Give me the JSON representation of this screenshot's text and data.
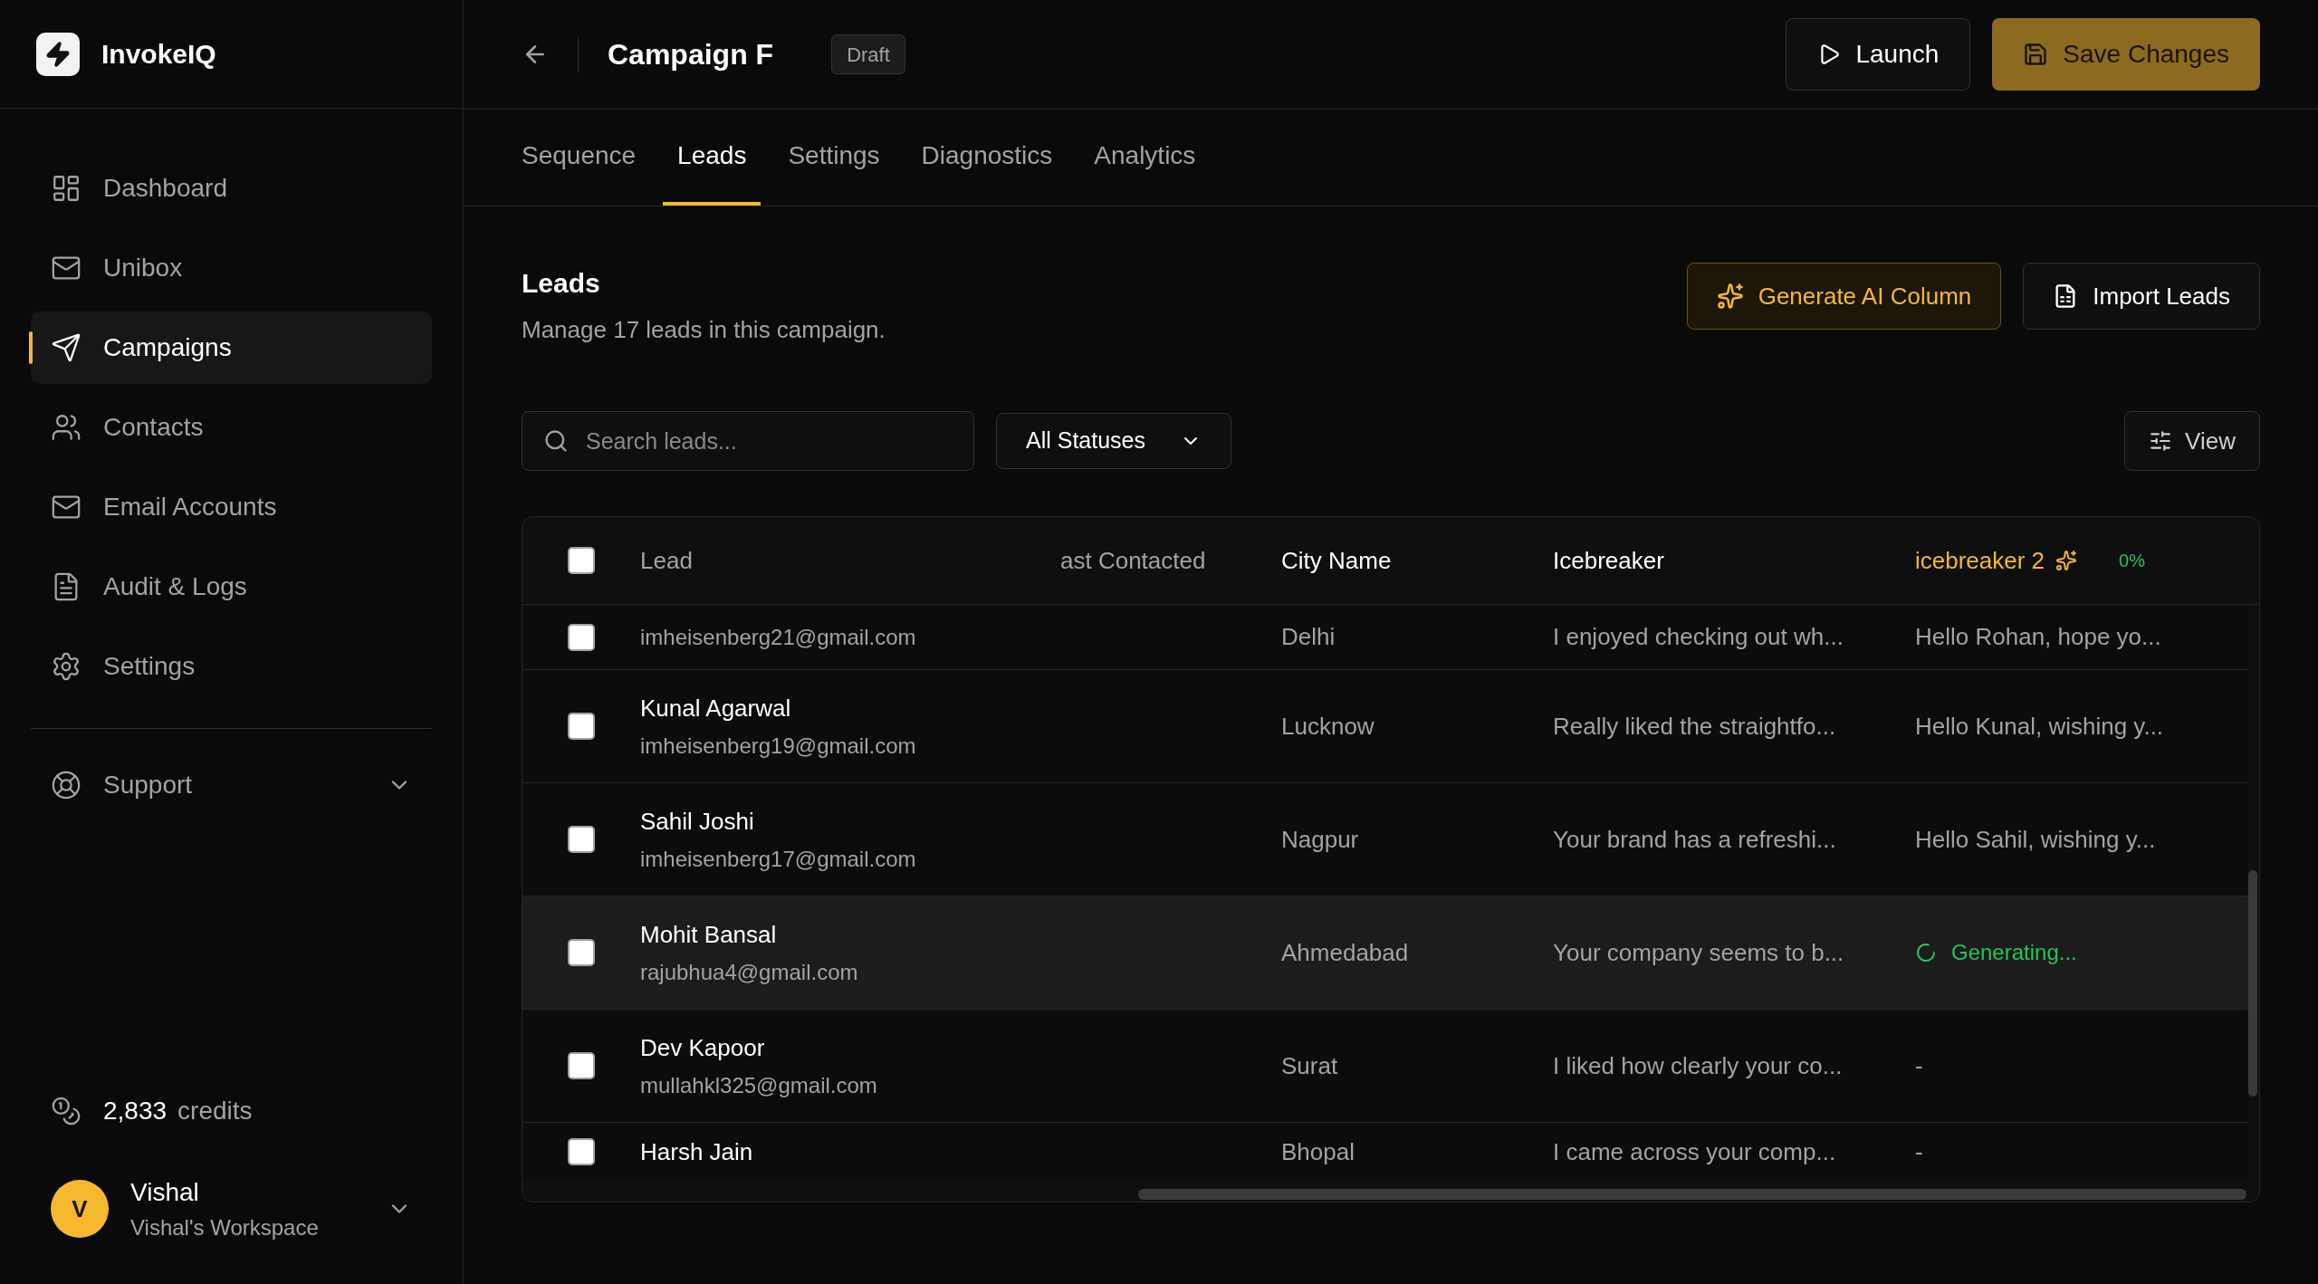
{
  "app": {
    "name": "InvokeIQ"
  },
  "sidebar": {
    "items": [
      {
        "label": "Dashboard",
        "selected": false
      },
      {
        "label": "Unibox",
        "selected": false
      },
      {
        "label": "Campaigns",
        "selected": true
      },
      {
        "label": "Contacts",
        "selected": false
      },
      {
        "label": "Email Accounts",
        "selected": false
      },
      {
        "label": "Audit & Logs",
        "selected": false
      },
      {
        "label": "Settings",
        "selected": false
      }
    ],
    "support": {
      "label": "Support",
      "expanded": false
    },
    "credits": {
      "value": "2,833",
      "label": "credits"
    },
    "user": {
      "initial": "V",
      "name": "Vishal",
      "workspace": "Vishal's Workspace"
    }
  },
  "header": {
    "title": "Campaign F",
    "badge": "Draft",
    "launch": "Launch",
    "save": "Save Changes"
  },
  "tabs": [
    {
      "label": "Sequence",
      "selected": false
    },
    {
      "label": "Leads",
      "selected": true
    },
    {
      "label": "Settings",
      "selected": false
    },
    {
      "label": "Diagnostics",
      "selected": false
    },
    {
      "label": "Analytics",
      "selected": false
    }
  ],
  "leads": {
    "title": "Leads",
    "subtitle": "Manage 17 leads in this campaign.",
    "generate": "Generate AI Column",
    "import": "Import Leads",
    "search": {
      "placeholder": "Search leads..."
    },
    "status_filter": "All Statuses",
    "view": "View"
  },
  "table": {
    "select_all": {
      "checked": false
    },
    "columns": {
      "lead": "Lead",
      "last_contacted": "ast Contacted",
      "city": "City Name",
      "icebreaker": "Icebreaker",
      "icebreaker2": "icebreaker 2",
      "progress": "0%"
    },
    "rows": [
      {
        "email": "imheisenberg21@gmail.com",
        "city": "Delhi",
        "icebreaker": "I enjoyed checking out wh...",
        "ai": {
          "kind": "text",
          "text": "Hello Rohan, hope yo..."
        },
        "checked": false,
        "highlighted": false
      },
      {
        "name": "Kunal Agarwal",
        "email": "imheisenberg19@gmail.com",
        "city": "Lucknow",
        "icebreaker": "Really liked the straightfo...",
        "ai": {
          "kind": "text",
          "text": "Hello Kunal, wishing y..."
        },
        "checked": false,
        "highlighted": false
      },
      {
        "name": "Sahil Joshi",
        "email": "imheisenberg17@gmail.com",
        "city": "Nagpur",
        "icebreaker": "Your brand has a refreshi...",
        "ai": {
          "kind": "text",
          "text": "Hello Sahil, wishing y..."
        },
        "checked": false,
        "highlighted": false
      },
      {
        "name": "Mohit Bansal",
        "email": "rajubhua4@gmail.com",
        "city": "Ahmedabad",
        "icebreaker": "Your company seems to b...",
        "ai": {
          "kind": "generating",
          "text": "Generating..."
        },
        "checked": false,
        "highlighted": true
      },
      {
        "name": "Dev Kapoor",
        "email": "mullahkl325@gmail.com",
        "city": "Surat",
        "icebreaker": "I liked how clearly your co...",
        "ai": {
          "kind": "empty",
          "text": "-"
        },
        "checked": false,
        "highlighted": false
      },
      {
        "name": "Harsh Jain",
        "city": "Bhopal",
        "icebreaker": "I came across your comp...",
        "ai": {
          "kind": "empty",
          "text": "-"
        },
        "checked": false,
        "highlighted": false
      }
    ]
  }
}
